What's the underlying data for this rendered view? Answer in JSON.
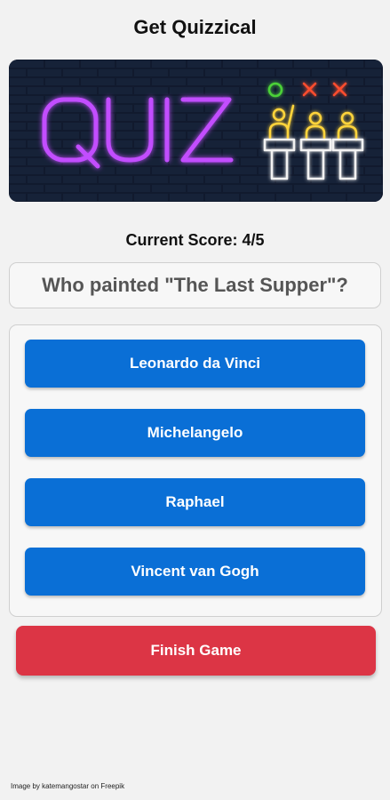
{
  "header": {
    "title": "Get Quizzical"
  },
  "banner": {
    "word": "QUIZ",
    "word_color": "#c24dff",
    "contestant_status": [
      {
        "icon": "circle-icon",
        "color": "#4cd137"
      },
      {
        "icon": "x-mark-icon",
        "color": "#ff4d2e"
      },
      {
        "icon": "x-mark-icon",
        "color": "#ff4d2e"
      }
    ],
    "contestant_color": "#ffd43b",
    "podium_color": "#f2f2f2"
  },
  "quiz": {
    "score_text": "Current Score: 4/5",
    "question": "Who painted \"The Last Supper\"?",
    "answers": [
      "Leonardo da Vinci",
      "Michelangelo",
      "Raphael",
      "Vincent van Gogh"
    ],
    "finish_label": "Finish Game"
  },
  "footer": {
    "credit": "Image by katemangostar on Freepik"
  },
  "colors": {
    "answer_button": "#0a6fd6",
    "finish_button": "#dc3545",
    "background": "#f2f2f2"
  }
}
